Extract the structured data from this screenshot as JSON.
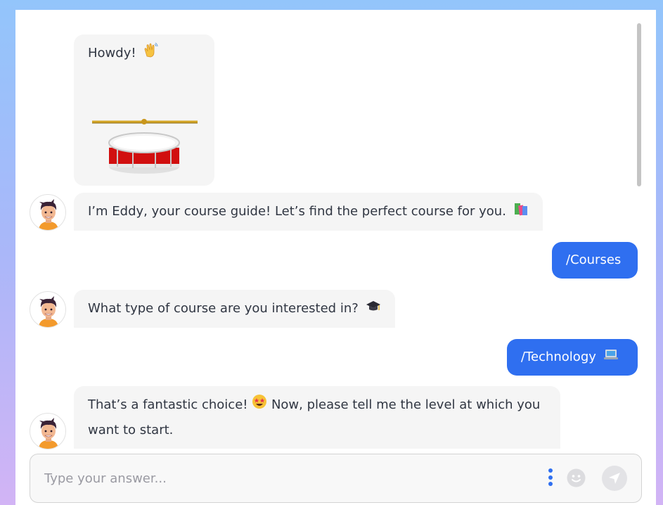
{
  "messages": [
    {
      "role": "bot",
      "text": "Howdy! ",
      "emoji": "waving-hand-icon",
      "media": "drum-image"
    },
    {
      "role": "bot",
      "text": "I’m Eddy, your course guide! Let’s find the perfect course for you. ",
      "emoji": "books-icon"
    },
    {
      "role": "user",
      "text": "/Courses"
    },
    {
      "role": "bot",
      "text": "What type of course are you interested in? ",
      "emoji": "graduation-cap-icon"
    },
    {
      "role": "user",
      "text": "/Technology ",
      "emoji": "laptop-icon"
    },
    {
      "role": "bot",
      "text_line1": "That’s a fantastic choice! ",
      "emoji": "star-struck-icon",
      "text_line1_after": " Now, please tell me the level at which you",
      "text_line2": "want to start."
    }
  ],
  "composer": {
    "placeholder": "Type your answer...",
    "menu_icon": "more-vertical-icon",
    "emoji_icon": "smiley-icon",
    "send_icon": "send-icon"
  },
  "colors": {
    "user_bubble": "#2f6ff0",
    "bot_bubble": "#f5f5f5",
    "text": "#303642",
    "accent": "#2f6ff0"
  }
}
